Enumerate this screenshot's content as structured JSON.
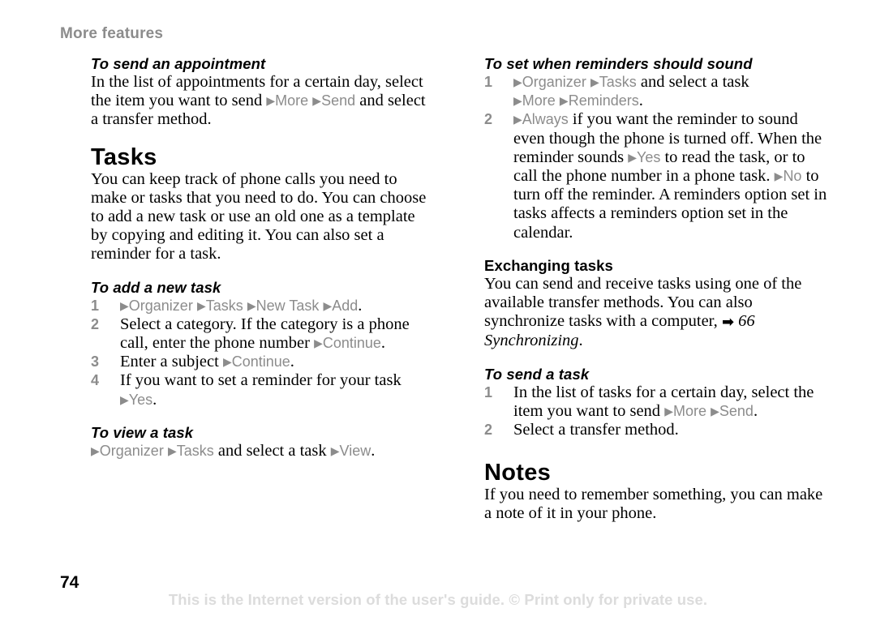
{
  "header": {
    "running_title": "More features"
  },
  "footer": {
    "page_number": "74",
    "watermark": "This is the Internet version of the user's guide. © Print only for private use."
  },
  "glyphs": {
    "triangle": "▶",
    "xref_arrow": "➡"
  },
  "colors": {
    "command_gray": "#8c8c8c",
    "header_gray": "#8c8c8c",
    "watermark_gray": "#dcdcdc",
    "text_black": "#000000"
  },
  "left_column": {
    "appointment_heading": "To send an appointment",
    "appointment_body_1": "In the list of appointments for a certain day, select the item you want to send ",
    "appointment_cmd_more": "More",
    "appointment_cmd_send": "Send",
    "appointment_body_2": " and select a transfer method.",
    "tasks_title": "Tasks",
    "tasks_intro": "You can keep track of phone calls you need to make or tasks that you need to do. You can choose to add a new task or use an old one as a template by copying and editing it. You can also set a reminder for a task.",
    "add_task_heading": "To add a new task",
    "add_task_steps": [
      {
        "num": "1",
        "parts": [
          {
            "type": "cmd",
            "text": "Organizer"
          },
          {
            "type": "cmd",
            "text": "Tasks"
          },
          {
            "type": "cmd",
            "text": "New Task"
          },
          {
            "type": "cmd",
            "text": "Add"
          },
          {
            "type": "text",
            "text": "."
          }
        ]
      },
      {
        "num": "2",
        "parts": [
          {
            "type": "text_lead",
            "text": "Select a category. If the category is a phone call, enter the phone number "
          },
          {
            "type": "cmd",
            "text": "Continue"
          },
          {
            "type": "text",
            "text": "."
          }
        ]
      },
      {
        "num": "3",
        "parts": [
          {
            "type": "text_lead",
            "text": "Enter a subject "
          },
          {
            "type": "cmd",
            "text": "Continue"
          },
          {
            "type": "text",
            "text": "."
          }
        ]
      },
      {
        "num": "4",
        "parts": [
          {
            "type": "text_lead",
            "text": "If you want to set a reminder for your task "
          },
          {
            "type": "cmd",
            "text": "Yes"
          },
          {
            "type": "text",
            "text": "."
          }
        ]
      }
    ],
    "view_task_heading": "To view a task",
    "view_task_cmd_organizer": "Organizer",
    "view_task_cmd_tasks": "Tasks",
    "view_task_mid": " and select a task ",
    "view_task_cmd_view": "View",
    "view_task_end": "."
  },
  "right_column": {
    "reminders_heading": "To set when reminders should sound",
    "reminders_step_1": {
      "num": "1",
      "cmd_organizer": "Organizer",
      "cmd_tasks": "Tasks",
      "mid": " and select a task ",
      "cmd_more": "More",
      "cmd_reminders": "Reminders",
      "end": "."
    },
    "reminders_step_2": {
      "num": "2",
      "cmd_always": "Always",
      "text_1": " if you want the reminder to sound even though the phone is turned off. When the reminder sounds ",
      "cmd_yes": "Yes",
      "text_2": " to read the task, or to call the phone number in a phone task. ",
      "cmd_no": "No",
      "text_3": " to turn off the reminder. A reminders option set in tasks affects a reminders option set in the calendar."
    },
    "exchanging_heading": "Exchanging tasks",
    "exchanging_body_1": "You can send and receive tasks using one of the available transfer methods. You can also synchronize tasks with a computer, ",
    "exchanging_xref": "66 Synchronizing",
    "exchanging_body_2": ".",
    "send_task_heading": "To send a task",
    "send_task_steps": [
      {
        "num": "1",
        "lead": "In the list of tasks for a certain day, select the item you want to send ",
        "cmd_more": "More",
        "cmd_send": "Send",
        "end": "."
      },
      {
        "num": "2",
        "lead": "Select a transfer method.",
        "cmd_more": "",
        "cmd_send": "",
        "end": ""
      }
    ],
    "notes_title": "Notes",
    "notes_body": "If you need to remember something, you can make a note of it in your phone."
  }
}
